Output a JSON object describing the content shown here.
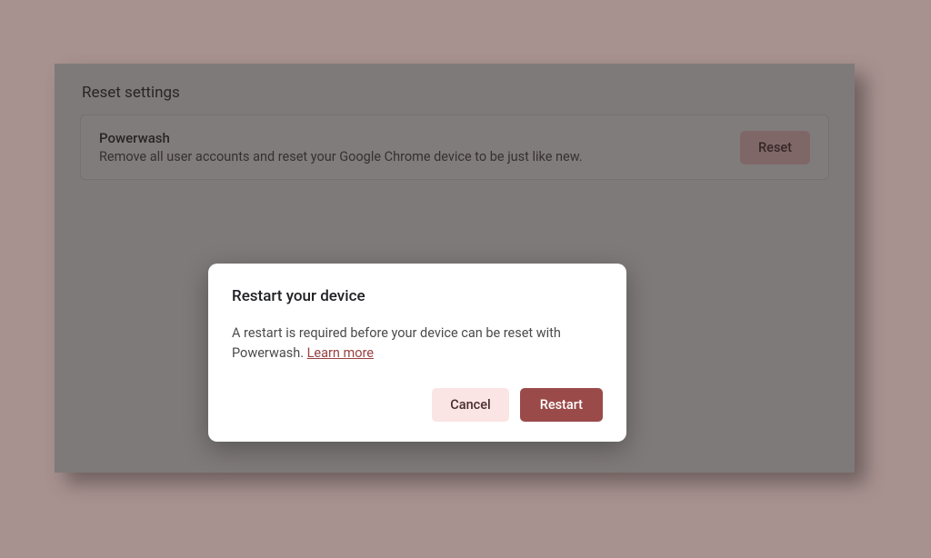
{
  "section": {
    "title": "Reset settings"
  },
  "card": {
    "title": "Powerwash",
    "description": "Remove all user accounts and reset your Google Chrome device to be just like new.",
    "button_label": "Reset"
  },
  "dialog": {
    "title": "Restart your device",
    "body_text": "A restart is required before your device can be reset with Powerwash. ",
    "learn_more_label": "Learn more",
    "cancel_label": "Cancel",
    "confirm_label": "Restart"
  }
}
